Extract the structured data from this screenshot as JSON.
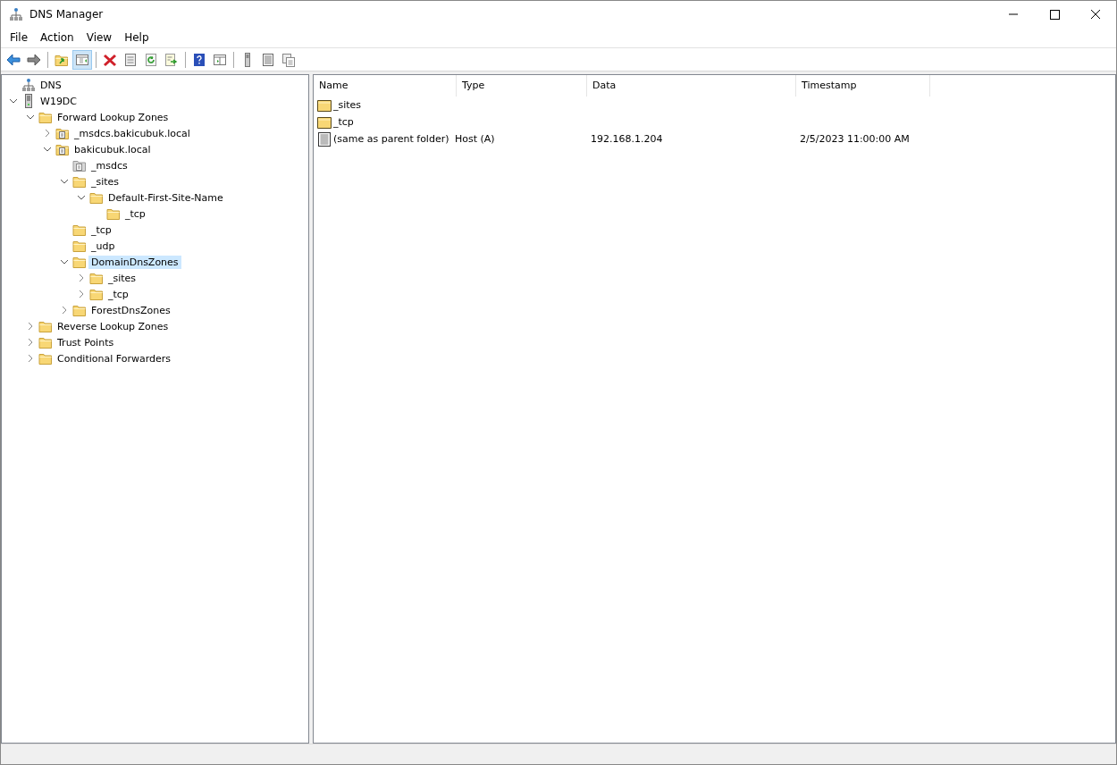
{
  "window": {
    "title": "DNS Manager"
  },
  "menu": [
    {
      "label": "File"
    },
    {
      "label": "Action"
    },
    {
      "label": "View"
    },
    {
      "label": "Help"
    }
  ],
  "toolbar": [
    {
      "kind": "back",
      "pressed": false
    },
    {
      "kind": "forward",
      "pressed": false
    },
    {
      "kind": "sep"
    },
    {
      "kind": "up",
      "pressed": false
    },
    {
      "kind": "tree",
      "pressed": true
    },
    {
      "kind": "sep"
    },
    {
      "kind": "delete",
      "pressed": false
    },
    {
      "kind": "props",
      "pressed": false
    },
    {
      "kind": "refresh",
      "pressed": false
    },
    {
      "kind": "export",
      "pressed": false
    },
    {
      "kind": "sep"
    },
    {
      "kind": "help",
      "pressed": false
    },
    {
      "kind": "pane",
      "pressed": false
    },
    {
      "kind": "sep"
    },
    {
      "kind": "server",
      "pressed": false
    },
    {
      "kind": "list",
      "pressed": false
    },
    {
      "kind": "copy",
      "pressed": false
    }
  ],
  "tree": [
    {
      "label": "DNS",
      "kind": "dns",
      "selected": false,
      "children": [
        {
          "label": "W19DC",
          "kind": "server",
          "expanded": true,
          "selected": false,
          "children": [
            {
              "label": "Forward Lookup Zones",
              "kind": "folder",
              "expanded": true,
              "selected": false,
              "children": [
                {
                  "label": "_msdcs.bakicubuk.local",
                  "kind": "zone",
                  "expanded": false,
                  "selected": false
                },
                {
                  "label": "bakicubuk.local",
                  "kind": "zone",
                  "expanded": true,
                  "selected": false,
                  "children": [
                    {
                      "label": "_msdcs",
                      "kind": "delegation",
                      "selected": false
                    },
                    {
                      "label": "_sites",
                      "kind": "folder",
                      "expanded": true,
                      "selected": false,
                      "children": [
                        {
                          "label": "Default-First-Site-Name",
                          "kind": "folder",
                          "expanded": true,
                          "selected": false,
                          "children": [
                            {
                              "label": "_tcp",
                              "kind": "folder",
                              "selected": false
                            }
                          ]
                        }
                      ]
                    },
                    {
                      "label": "_tcp",
                      "kind": "folder",
                      "selected": false
                    },
                    {
                      "label": "_udp",
                      "kind": "folder",
                      "selected": false
                    },
                    {
                      "label": "DomainDnsZones",
                      "kind": "folder",
                      "expanded": true,
                      "selected": true,
                      "children": [
                        {
                          "label": "_sites",
                          "kind": "folder",
                          "expanded": false,
                          "selected": false
                        },
                        {
                          "label": "_tcp",
                          "kind": "folder",
                          "expanded": false,
                          "selected": false
                        }
                      ]
                    },
                    {
                      "label": "ForestDnsZones",
                      "kind": "folder",
                      "expanded": false,
                      "selected": false
                    }
                  ]
                }
              ]
            },
            {
              "label": "Reverse Lookup Zones",
              "kind": "folder",
              "expanded": false,
              "selected": false
            },
            {
              "label": "Trust Points",
              "kind": "folder",
              "expanded": false,
              "selected": false
            },
            {
              "label": "Conditional Forwarders",
              "kind": "folder",
              "expanded": false,
              "selected": false
            }
          ]
        }
      ]
    }
  ],
  "table": {
    "columns": [
      "Name",
      "Type",
      "Data",
      "Timestamp"
    ],
    "rows": [
      {
        "kind": "folder",
        "cells": [
          "_sites"
        ]
      },
      {
        "kind": "folder",
        "cells": [
          "_tcp"
        ]
      },
      {
        "kind": "record",
        "cells": [
          "(same as parent folder)",
          "Host (A)",
          "192.168.1.204",
          "2/5/2023 11:00:00 AM"
        ]
      }
    ]
  }
}
